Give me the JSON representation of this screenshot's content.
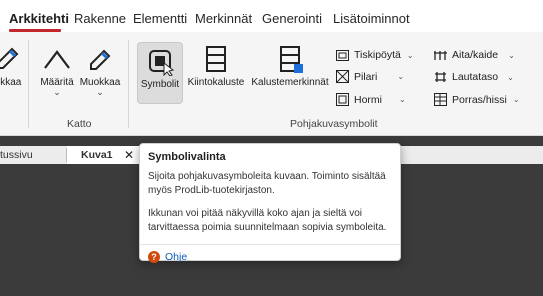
{
  "menu": {
    "tabs": [
      "Arkkitehti",
      "Rakenne",
      "Elementti",
      "Merkinnät",
      "Generointi",
      "Lisätoiminnot"
    ]
  },
  "ribbon": {
    "partial_left_label": "ukkaa",
    "katto": {
      "label": "Katto",
      "maarita": "Määritä",
      "muokkaa": "Muokkaa"
    },
    "pohjakuvasymbolit": {
      "label": "Pohjakuvasymbolit",
      "symbolit": "Symbolit",
      "kiintokaluste": "Kiintokaluste",
      "kalustemerkinnat": "Kalustemerkinnät",
      "small": {
        "col1": [
          "Tiskipöytä",
          "Pilari",
          "Hormi"
        ],
        "col2": [
          "Aita/kaide",
          "Lautataso",
          "Porras/hissi"
        ]
      }
    }
  },
  "documents": {
    "partial_tab": "tussivu",
    "active_tab": "Kuva1"
  },
  "tooltip": {
    "title": "Symbolivalinta",
    "body1": "Sijoita pohjakuvasymboleita kuvaan. Toiminto sisältää myös ProdLib-tuotekirjaston.",
    "body2": "Ikkunan voi pitää näkyvillä koko ajan ja sieltä voi tarvittaessa poimia suunnitelmaan sopivia symboleita.",
    "help": "Ohje"
  },
  "colors": {
    "accent": "#c4262e",
    "link": "#0b5db6",
    "help_icon": "#d04a0e",
    "workspace": "#3b3b3b"
  }
}
